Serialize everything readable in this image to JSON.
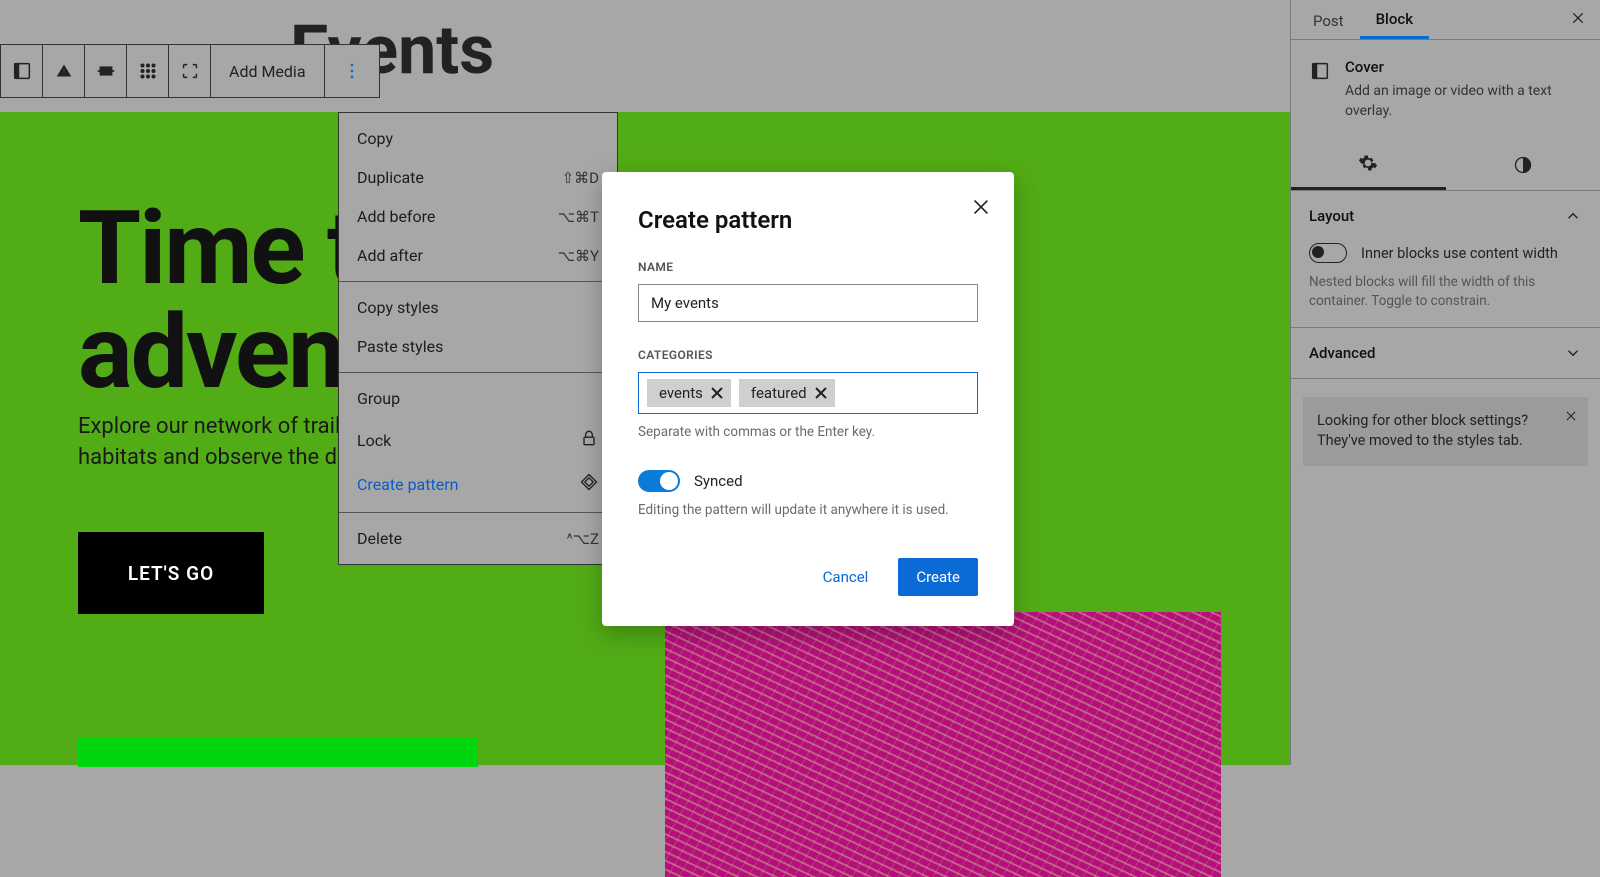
{
  "page": {
    "title": "Events",
    "hero_heading": "Time to\nadventure",
    "hero_body": "Explore our network of trails that lead through a variety of woodland\nhabitats and observe the diverse fauna.",
    "hero_button": "LET'S GO"
  },
  "toolbar": {
    "add_media": "Add Media"
  },
  "dropdown": {
    "groups": [
      [
        {
          "label": "Copy",
          "shortcut": ""
        },
        {
          "label": "Duplicate",
          "shortcut": "⇧⌘D"
        },
        {
          "label": "Add before",
          "shortcut": "⌥⌘T"
        },
        {
          "label": "Add after",
          "shortcut": "⌥⌘Y"
        }
      ],
      [
        {
          "label": "Copy styles",
          "shortcut": ""
        },
        {
          "label": "Paste styles",
          "shortcut": ""
        }
      ],
      [
        {
          "label": "Group",
          "icon": ""
        },
        {
          "label": "Lock",
          "icon": "lock"
        },
        {
          "label": "Create pattern",
          "icon": "diamond",
          "primary": true
        }
      ],
      [
        {
          "label": "Delete",
          "shortcut": "^⌥Z"
        }
      ]
    ]
  },
  "modal": {
    "title": "Create pattern",
    "name_label": "NAME",
    "name_value": "My events",
    "categories_label": "CATEGORIES",
    "tags": [
      "events",
      "featured"
    ],
    "categories_help": "Separate with commas or the Enter key.",
    "synced_label": "Synced",
    "synced_help": "Editing the pattern will update it anywhere it is used.",
    "cancel": "Cancel",
    "create": "Create"
  },
  "sidebar": {
    "tabs": {
      "post": "Post",
      "block": "Block"
    },
    "block": {
      "title": "Cover",
      "desc": "Add an image or video with a text overlay."
    },
    "layout": {
      "heading": "Layout",
      "toggle_label": "Inner blocks use content width",
      "help": "Nested blocks will fill the width of this container. Toggle to constrain."
    },
    "advanced": "Advanced",
    "notice": "Looking for other block settings? They've moved to the styles tab."
  }
}
